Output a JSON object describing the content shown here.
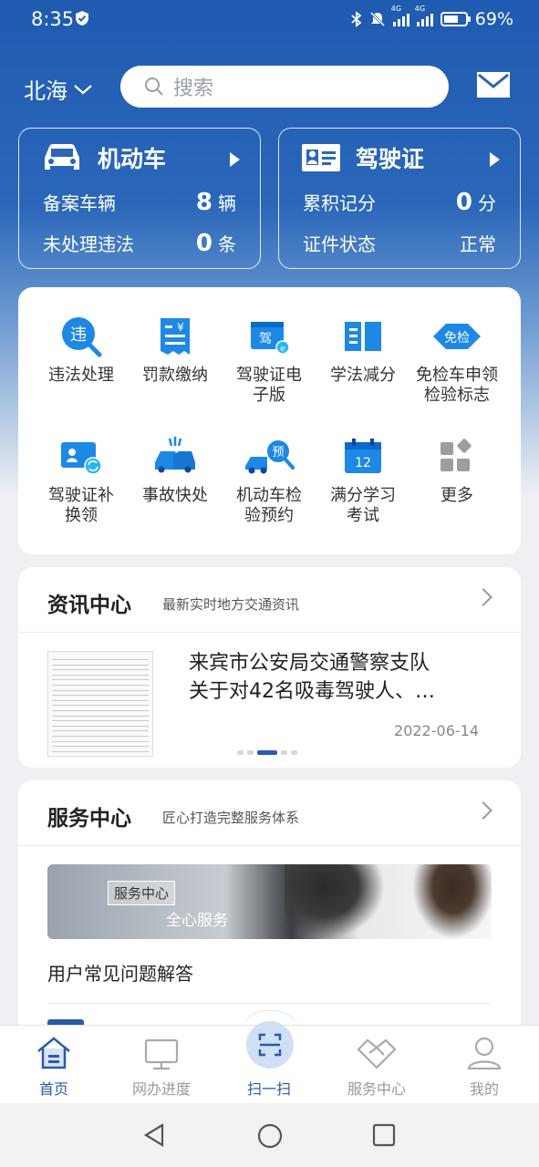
{
  "status": {
    "time": "8:35",
    "network1": "4G",
    "network2": "4G",
    "battery": "69%",
    "battery_level": 0.69
  },
  "header": {
    "city": "北海",
    "search_placeholder": "搜索"
  },
  "vehicle_card": {
    "title": "机动车",
    "rows": [
      {
        "label": "备案车辆",
        "value": "8",
        "unit": "辆"
      },
      {
        "label": "未处理违法",
        "value": "0",
        "unit": "条"
      }
    ]
  },
  "license_card": {
    "title": "驾驶证",
    "rows": [
      {
        "label": "累积记分",
        "value": "0",
        "unit": "分"
      },
      {
        "label": "证件状态",
        "value": "正常",
        "unit": ""
      }
    ]
  },
  "services": [
    {
      "label": "违法处理",
      "icon": "violation-search-icon"
    },
    {
      "label": "罚款缴纳",
      "icon": "fine-receipt-icon"
    },
    {
      "label": "驾驶证电子版",
      "icon": "e-license-icon"
    },
    {
      "label": "学法减分",
      "icon": "book-icon"
    },
    {
      "label": "免检车申领检验标志",
      "icon": "exempt-badge-icon",
      "badge": "免检"
    },
    {
      "label": "驾驶证补换领",
      "icon": "license-renew-icon"
    },
    {
      "label": "事故快处",
      "icon": "accident-icon"
    },
    {
      "label": "机动车检验预约",
      "icon": "inspection-booking-icon",
      "badge": "预"
    },
    {
      "label": "满分学习考试",
      "icon": "calendar-icon",
      "badge": "12"
    },
    {
      "label": "更多",
      "icon": "more-grid-icon"
    }
  ],
  "service_lines": [
    [
      "违法处理"
    ],
    [
      "罚款缴纳"
    ],
    [
      "驾驶证电",
      "子版"
    ],
    [
      "学法减分"
    ],
    [
      "免检车申领",
      "检验标志"
    ],
    [
      "驾驶证补",
      "换领"
    ],
    [
      "事故快处"
    ],
    [
      "机动车检",
      "验预约"
    ],
    [
      "满分学习",
      "考试"
    ],
    [
      "更多"
    ]
  ],
  "news": {
    "title": "资讯中心",
    "subtitle": "最新实时地方交通资讯",
    "headline_line1": "来宾市公安局交通警察支队",
    "headline_line2": "关于对42名吸毒驾驶人、…",
    "date": "2022-06-14"
  },
  "service_center": {
    "title": "服务中心",
    "subtitle": "匠心打造完整服务体系",
    "banner_tag": "服务中心",
    "banner_text": "全心服务",
    "faq": "用户常见问题解答"
  },
  "tabs": [
    {
      "label": "首页",
      "icon": "home-icon",
      "active": true
    },
    {
      "label": "网办进度",
      "icon": "monitor-icon",
      "active": false
    },
    {
      "label": "扫一扫",
      "icon": "scan-icon",
      "active": false
    },
    {
      "label": "服务中心",
      "icon": "handshake-icon",
      "active": false
    },
    {
      "label": "我的",
      "icon": "user-icon",
      "active": false
    }
  ],
  "colors": {
    "primary": "#2a5ba8",
    "accent_blue": "#1e88e5",
    "hero_top": "#1f5bb0"
  }
}
